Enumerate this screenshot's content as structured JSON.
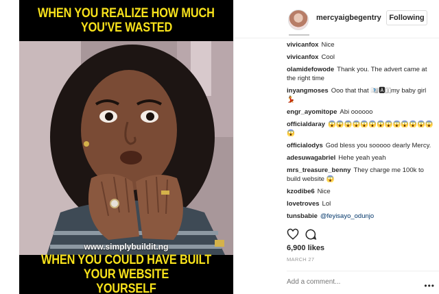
{
  "meme": {
    "top_line1": "WHEN YOU REALIZE HOW MUCH",
    "top_line2": "YOU'VE WASTED",
    "watermark": "www.simplybuildit.ng",
    "bottom_line1": "WHEN YOU COULD HAVE BUILT YOUR WEBSITE",
    "bottom_line2": "YOURSELF"
  },
  "post": {
    "username": "mercyaigbegentry",
    "follow_label": "Following",
    "likes": "6,900 likes",
    "date": "MARCH 27",
    "add_comment_placeholder": "Add a comment...",
    "more_label": "•••"
  },
  "comments": [
    {
      "user": "vivicanfox",
      "text": "Nice"
    },
    {
      "user": "vivicanfox",
      "text": "Cool"
    },
    {
      "user": "olamidefowode",
      "text": "Thank you. The advert came at the right time"
    },
    {
      "user": "inyangmoses",
      "text": "Ooo that that 🇮🇽🅰🇮my baby girl 💃"
    },
    {
      "user": "engr_ayomitope",
      "text": "Abi oooooo"
    },
    {
      "user": "officialdaray",
      "text": "😱😱😱😱😱😱😱😱😱😱😱😱😱😱"
    },
    {
      "user": "officialodys",
      "text": "God bless you sooooo dearly Mercy."
    },
    {
      "user": "adesuwagabriel",
      "text": "Hehe yeah yeah"
    },
    {
      "user": "mrs_treasure_benny",
      "text": "They charge me 100k to build website 😱"
    },
    {
      "user": "kzodibe6",
      "text": "Nice"
    },
    {
      "user": "lovetroves",
      "text": "Lol"
    },
    {
      "user": "tunsbabie",
      "text": "@feyisayo_odunjo"
    }
  ],
  "colors": {
    "meme_yellow": "#f8e21b",
    "text_dark": "#262626",
    "mention_blue": "#003569"
  },
  "icons": {
    "like": "heart-icon",
    "comment": "comment-icon",
    "more": "more-icon"
  }
}
